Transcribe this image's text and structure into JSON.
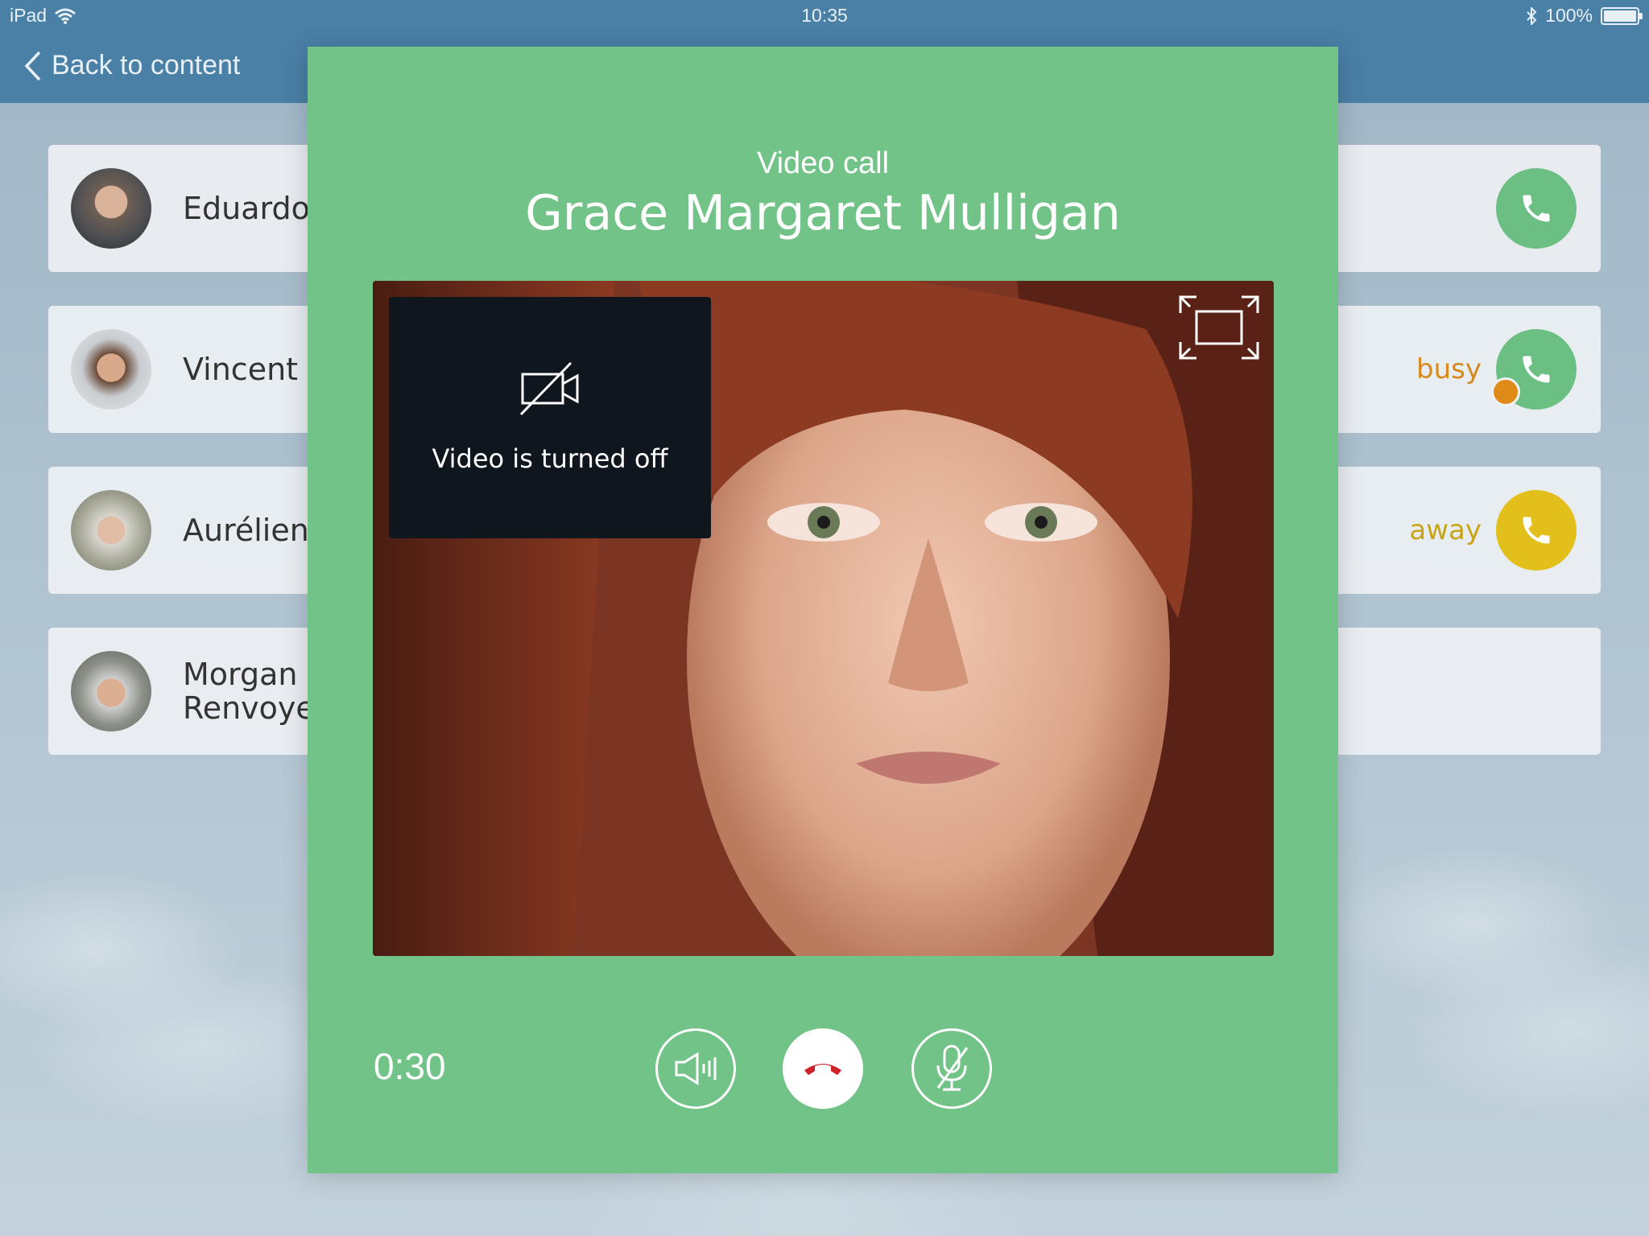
{
  "status_bar": {
    "device": "iPad",
    "time": "10:35",
    "battery": "100%"
  },
  "nav": {
    "back_label": "Back to content"
  },
  "contacts": [
    {
      "name": "Eduardo",
      "status": "",
      "call_color": "#6cbf83"
    },
    {
      "name": "Vincent T",
      "status": "busy",
      "status_color": "#d68a1c",
      "call_color": "#6cbf83"
    },
    {
      "name": "Aurélien",
      "status": "away",
      "status_color": "#c9a416",
      "call_color": "#e3bf1b"
    },
    {
      "name": "Morgan E\nRenvoye",
      "status": ""
    }
  ],
  "call": {
    "title": "Video call",
    "caller_name": "Grace Margaret Mulligan",
    "self_view_message": "Video is turned off",
    "duration": "0:30",
    "colors": {
      "panel": "#72c387",
      "hangup": "#d0202a"
    },
    "icons": [
      "camera-off-icon",
      "fullscreen-icon",
      "speaker-icon",
      "hangup-icon",
      "mic-muted-icon"
    ]
  }
}
